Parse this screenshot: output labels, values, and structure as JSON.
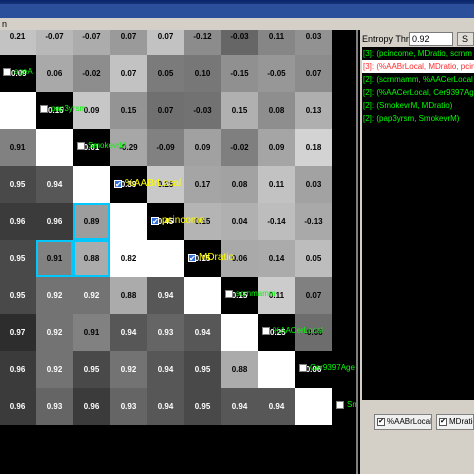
{
  "window": {
    "tab_label": "n"
  },
  "entropy": {
    "label": "Entropy Thr...",
    "value": "0.92",
    "button_label": "S"
  },
  "rules": [
    {
      "text": "[3]: (pcincome, MDratio, scrnm",
      "selected": false
    },
    {
      "text": "[3]: (%AABrLocal, MDratio, pcinc",
      "selected": true
    },
    {
      "text": "[2]: (scrnmamm, %AACerLocal",
      "selected": false
    },
    {
      "text": "[2]: (%AACerLocal, Cer9397Age",
      "selected": false
    },
    {
      "text": "[2]: (SmokevrM, MDratio)",
      "selected": false
    },
    {
      "text": "[2]: (pap3yrsm, SmokevrM)",
      "selected": false
    }
  ],
  "selected_attrs": [
    {
      "label": "%AABrLocal",
      "checked": "✔"
    },
    {
      "label": "MDratio",
      "checked": "✔"
    }
  ],
  "matrix": {
    "grays": [
      "#7a7a7a",
      "#8e8e8e",
      "#a6a6a6",
      "#9a9a9a",
      "#888888",
      "#b0b0b0",
      "#6e6e6e",
      "#5e5e5e",
      "#6a6a6a",
      "#8a8a8a"
    ],
    "rows": [
      {
        "cells": [
          "",
          "0.21",
          "-0.07",
          "-0.07",
          "0.07",
          "0.07",
          "-0.12",
          "-0.03",
          "0.11",
          "0.03"
        ],
        "label": ""
      },
      {
        "cells": [
          "",
          "-0.09",
          "0.06",
          "-0.02",
          "0.07",
          "0.05",
          "0.10",
          "-0.15",
          "-0.05",
          "0.07"
        ],
        "label": "ageA"
      },
      {
        "cells": [
          "",
          "",
          "-0.15",
          "0.09",
          "0.15",
          "0.07",
          "-0.03",
          "0.15",
          "0.08",
          "0.13"
        ],
        "label": "pap3yrsm"
      },
      {
        "cells": [
          "",
          "0.91",
          "",
          "0.01",
          "-0.29",
          "-0.09",
          "0.09",
          "-0.02",
          "0.09",
          "0.18"
        ],
        "label": "SmokevrM"
      },
      {
        "cells": [
          "",
          "0.95",
          "0.94",
          "",
          "0.39",
          "0.25",
          "0.17",
          "0.08",
          "0.11",
          "0.03"
        ],
        "label": "%AABrLocal"
      },
      {
        "cells": [
          "",
          "0.96",
          "0.96",
          "0.89",
          "",
          "0.45",
          "0.15",
          "0.04",
          "-0.14",
          "-0.13"
        ],
        "label": "pcincome"
      },
      {
        "cells": [
          "",
          "0.95",
          "0.91",
          "0.88",
          "0.82",
          "",
          "0.15",
          "0.06",
          "0.14",
          "0.05"
        ],
        "label": "MDratio"
      },
      {
        "cells": [
          "",
          "0.95",
          "0.92",
          "0.92",
          "0.88",
          "0.94",
          "",
          "0.15",
          "0.11",
          "0.07"
        ],
        "label": "scrnmamm"
      },
      {
        "cells": [
          "",
          "0.97",
          "0.92",
          "0.91",
          "0.94",
          "0.93",
          "0.94",
          "",
          "-0.25",
          "-0.06"
        ],
        "label": "%AACerLocal"
      },
      {
        "cells": [
          "",
          "0.96",
          "0.92",
          "0.95",
          "0.92",
          "0.94",
          "0.95",
          "0.88",
          "",
          "0.06"
        ],
        "label": "Cer9397Age"
      },
      {
        "cells": [
          "",
          "0.96",
          "0.93",
          "0.96",
          "0.93",
          "0.94",
          "0.95",
          "0.94",
          "0.94",
          ""
        ],
        "label": "SmokevrF"
      }
    ]
  }
}
